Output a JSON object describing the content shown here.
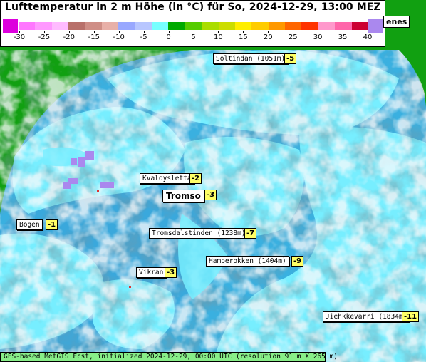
{
  "title": "Lufttemperatur in 2 m Höhe (in °C) für So, 2024-12-29, 13:00 MEZ",
  "colorbar": {
    "ticks": [
      "-30",
      "-25",
      "-20",
      "-15",
      "-10",
      "-5",
      "0",
      "5",
      "10",
      "15",
      "20",
      "25",
      "30",
      "35",
      "40"
    ],
    "colors": [
      "#ff77ff",
      "#ff99ff",
      "#ffbbff",
      "#b8706a",
      "#cf8e86",
      "#e8b0a8",
      "#99a8ff",
      "#b8c6ff",
      "#77ffff",
      "#00aa00",
      "#55cc00",
      "#aadd00",
      "#ccdd00",
      "#ffee00",
      "#ffcc00",
      "#ff9900",
      "#ff6600",
      "#ff3300",
      "#ff99cc",
      "#ff66aa",
      "#cc0033"
    ],
    "low_end_color": "#dd00dd",
    "high_end_color": "#aa88ee"
  },
  "corner_label": "enes",
  "places": [
    {
      "name": "Soltindan (1051m)",
      "value": "-5"
    },
    {
      "name": "Kvaloysletta",
      "value": "-2"
    },
    {
      "name": "Tromso",
      "value": "-3"
    },
    {
      "name": "Bogen",
      "value": "-1"
    },
    {
      "name": "Tromsdalstinden (1238m)",
      "value": "-7"
    },
    {
      "name": "Hamperokken (1404m)",
      "value": "-9"
    },
    {
      "name": "Vikran",
      "value": "-3"
    },
    {
      "name": "Jiehkkevarri (1834m)",
      "value": "-11"
    }
  ],
  "footer": "GFS-based MetGIS Fcst, initialized 2024-12-29, 00:00 UTC  (resolution 91 m X 265 m)",
  "colors": {
    "land_low": "#77eeff",
    "mountain_shade": "#3a4a55",
    "snow": "#f4f4f4",
    "outside": "#11a011"
  }
}
